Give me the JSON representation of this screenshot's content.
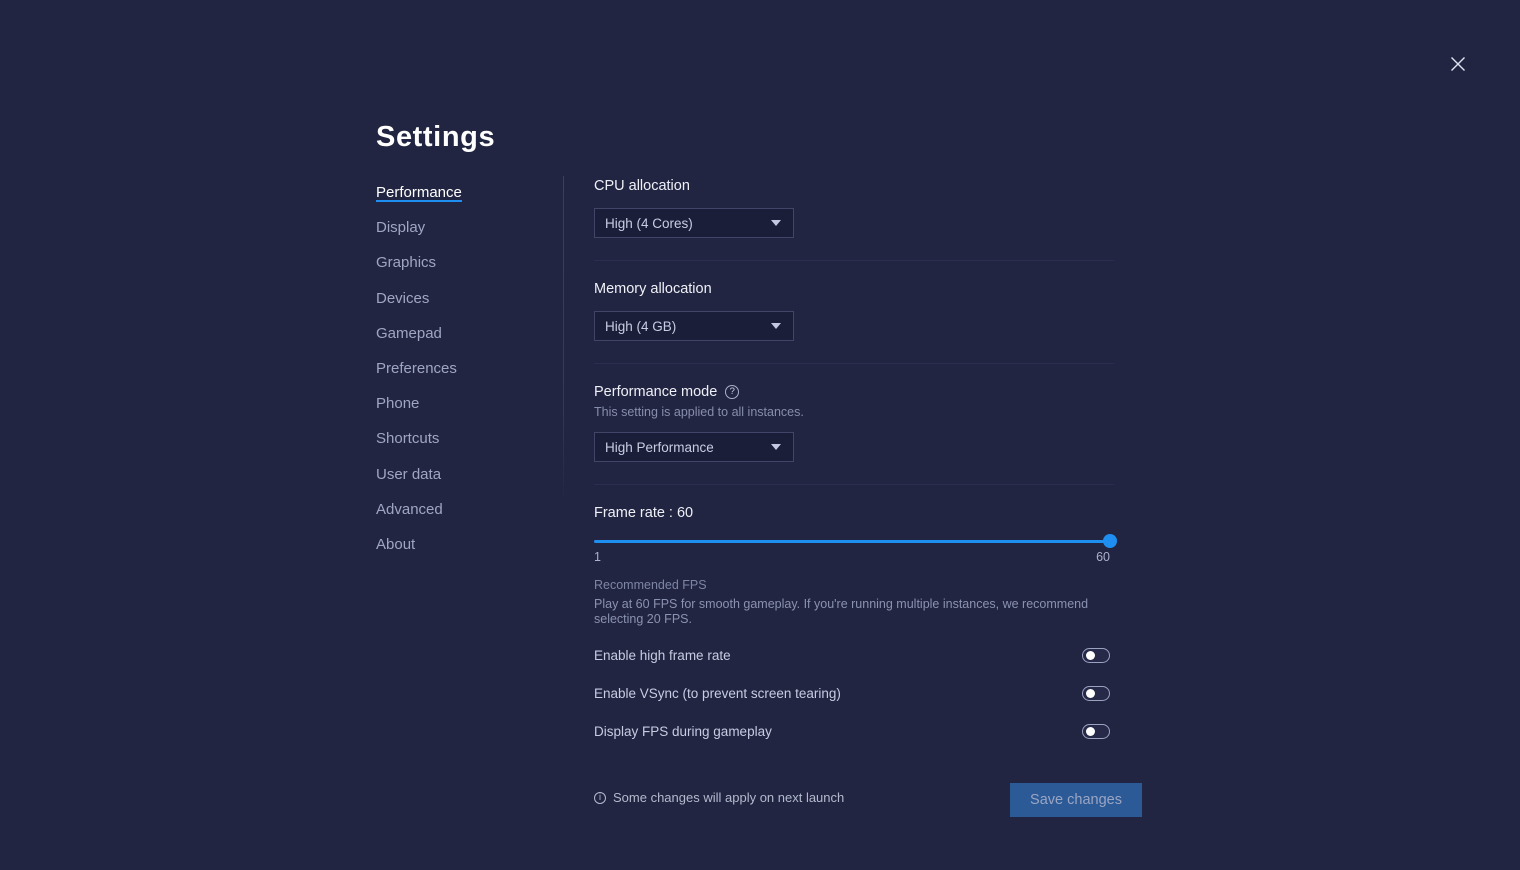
{
  "window": {
    "title": "Settings",
    "close_label": "close-icon"
  },
  "sidebar": {
    "items": [
      {
        "label": "Performance",
        "active": true
      },
      {
        "label": "Display",
        "active": false
      },
      {
        "label": "Graphics",
        "active": false
      },
      {
        "label": "Devices",
        "active": false
      },
      {
        "label": "Gamepad",
        "active": false
      },
      {
        "label": "Preferences",
        "active": false
      },
      {
        "label": "Phone",
        "active": false
      },
      {
        "label": "Shortcuts",
        "active": false
      },
      {
        "label": "User data",
        "active": false
      },
      {
        "label": "Advanced",
        "active": false
      },
      {
        "label": "About",
        "active": false
      }
    ]
  },
  "main": {
    "cpu": {
      "label": "CPU allocation",
      "value": "High (4 Cores)"
    },
    "memory": {
      "label": "Memory allocation",
      "value": "High (4 GB)"
    },
    "performance_mode": {
      "label": "Performance mode",
      "help_glyph": "?",
      "sublabel": "This setting is applied to all instances.",
      "value": "High Performance"
    },
    "frame_rate": {
      "label": "Frame rate : 60",
      "value": 60,
      "min": 1,
      "max": 60,
      "min_label": "1",
      "max_label": "60",
      "recommendation_title": "Recommended FPS",
      "recommendation_body": "Play at 60 FPS for smooth gameplay. If you're running multiple instances, we recommend selecting 20 FPS."
    },
    "toggles": [
      {
        "label": "Enable high frame rate",
        "on": false
      },
      {
        "label": "Enable VSync (to prevent screen tearing)",
        "on": false
      },
      {
        "label": "Display FPS during gameplay",
        "on": false
      }
    ],
    "footer": {
      "note": "Some changes will apply on next launch",
      "info_glyph": "i",
      "save_label": "Save changes"
    }
  },
  "colors": {
    "background": "#222541",
    "accent": "#1f8ef1",
    "panel_field": "#1b1e38",
    "save_button": "#2b5a96"
  }
}
